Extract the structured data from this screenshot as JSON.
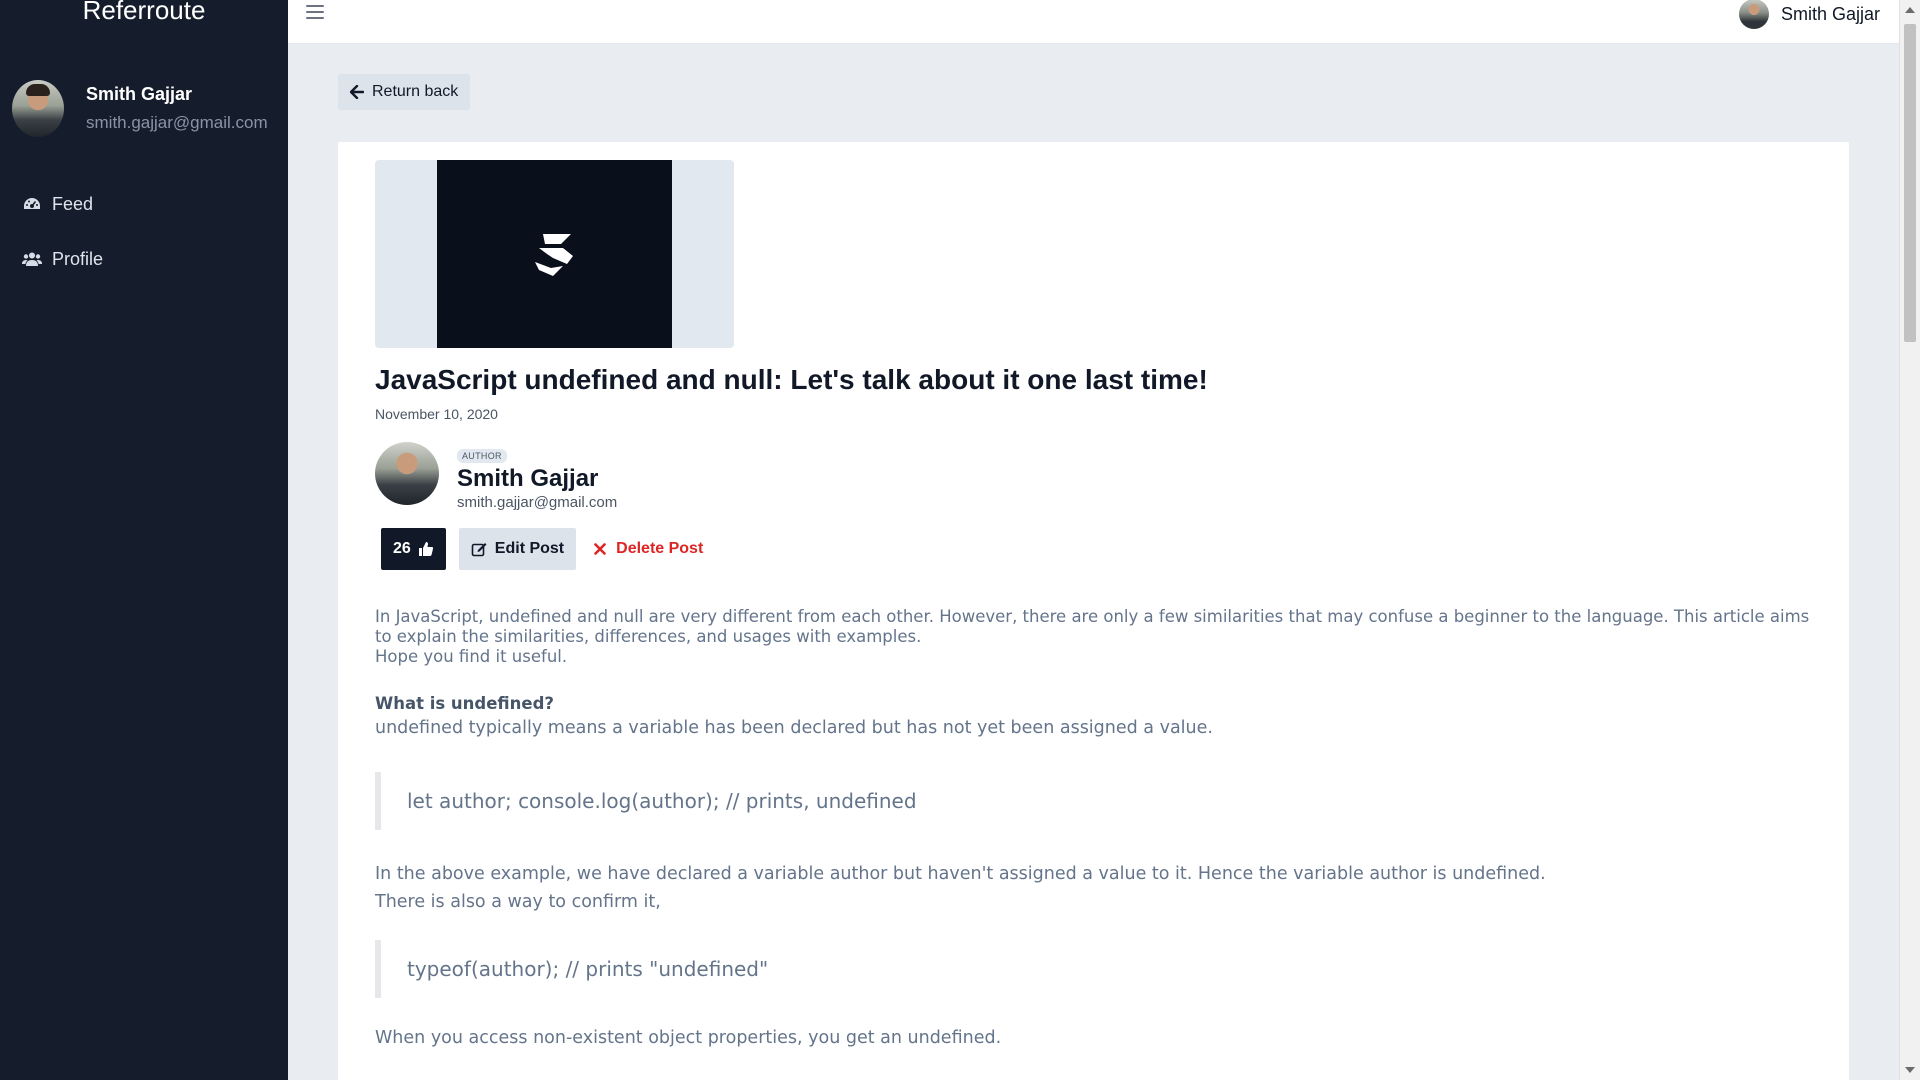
{
  "app": {
    "brand": "Referroute"
  },
  "sidebar": {
    "user_name": "Smith Gajjar",
    "user_email": "smith.gajjar@gmail.com",
    "items": [
      {
        "label": "Feed",
        "icon": "dashboard-icon"
      },
      {
        "label": "Profile",
        "icon": "users-icon"
      }
    ]
  },
  "topbar": {
    "user_name": "Smith Gajjar"
  },
  "nav": {
    "return_label": "Return back"
  },
  "post": {
    "title": "JavaScript undefined and null: Let's talk about it one last time!",
    "date": "November 10, 2020",
    "author_badge": "AUTHOR",
    "author_name": "Smith Gajjar",
    "author_email": "smith.gajjar@gmail.com",
    "likes": "26",
    "edit_label": "Edit Post",
    "delete_label": "Delete Post",
    "intro_line1": "In JavaScript, undefined and null are very different from each other. However, there are only a few similarities that may confuse a beginner to the language. This article aims to explain the similarities, differences, and usages with examples.",
    "intro_line2": "Hope you find it useful.",
    "heading_undefined": "What is undefined?",
    "undefined_desc": "undefined typically means a variable has been declared but has not yet been assigned a value.",
    "code1": "let author; console.log(author); // prints, undefined",
    "explain_line1": "In the above example, we have declared a variable author but haven't assigned a value to it. Hence the variable author is undefined.",
    "explain_line2": "There is also a way to confirm it,",
    "code2": "typeof(author); // prints \"undefined\"",
    "nonexistent": "When you access non-existent object properties, you get an undefined."
  },
  "colors": {
    "sidebar_bg": "#151d2d",
    "delete": "#dc2626",
    "like_bg": "#111827"
  }
}
